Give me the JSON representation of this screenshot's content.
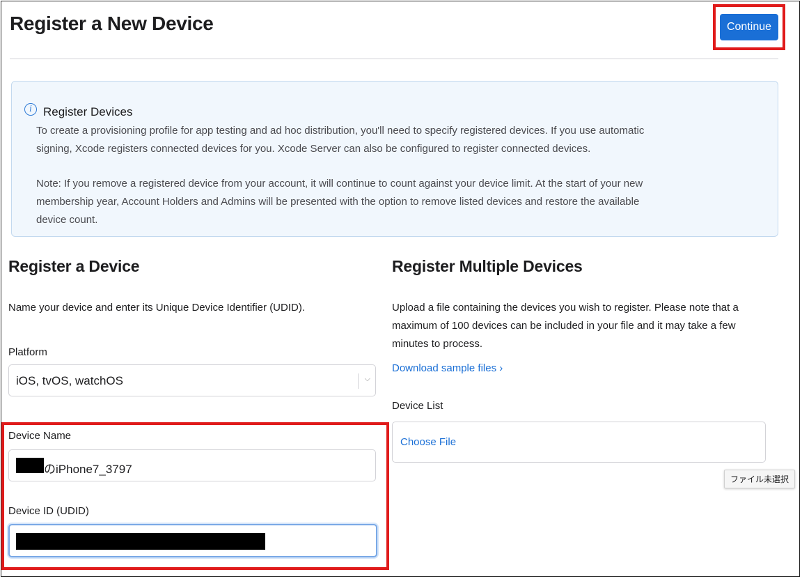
{
  "header": {
    "title": "Register a New Device",
    "continue_label": "Continue"
  },
  "info": {
    "title": "Register Devices",
    "paragraph1": "To create a provisioning profile for app testing and ad hoc distribution, you'll need to specify registered devices. If you use automatic signing, Xcode registers connected devices for you. Xcode Server can also be configured to register connected devices.",
    "paragraph2": "Note: If you remove a registered device from your account, it will continue to count against your device limit. At the start of your new membership year, Account Holders and Admins will be presented with the option to remove listed devices and restore the available device count."
  },
  "single": {
    "title": "Register a Device",
    "description": "Name your device and enter its Unique Device Identifier (UDID).",
    "platform_label": "Platform",
    "platform_value": "iOS, tvOS, watchOS",
    "device_name_label": "Device Name",
    "device_name_value": "のiPhone7_3797",
    "device_id_label": "Device ID (UDID)",
    "device_id_value": ""
  },
  "multiple": {
    "title": "Register Multiple Devices",
    "description": "Upload a file containing the devices you wish to register. Please note that a maximum of 100 devices can be included in your file and it may take a few minutes to process.",
    "download_link": "Download sample files ›",
    "device_list_label": "Device List",
    "choose_file_label": "Choose File",
    "file_tooltip": "ファイル未選択"
  },
  "colors": {
    "accent": "#1a6fd6",
    "highlight": "#e01b1b",
    "info_bg": "#f1f7fd"
  },
  "icons": {
    "info": "info-circle-icon",
    "select": "chevron-down-icon"
  }
}
